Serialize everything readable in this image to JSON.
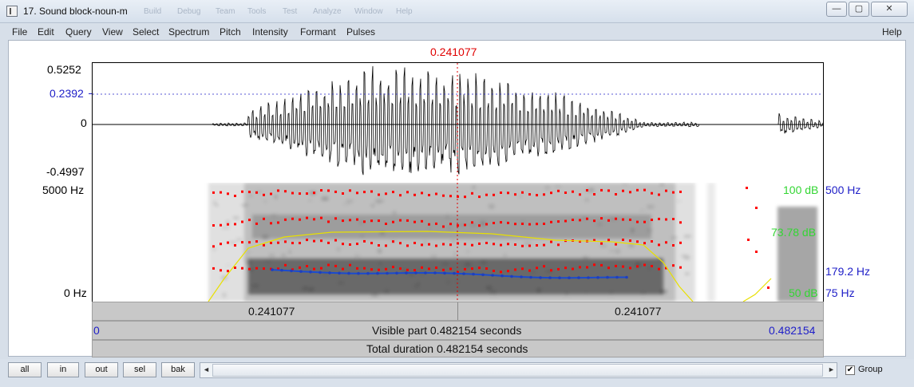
{
  "window": {
    "title": "17. Sound block-noun-m",
    "ghost_menu": [
      "Build",
      "Debug",
      "Team",
      "Tools",
      "Test",
      "Analyze",
      "Window",
      "Help"
    ],
    "minimize_glyph": "—",
    "restore_glyph": "▢",
    "close_glyph": "✕"
  },
  "menu": {
    "items": [
      "File",
      "Edit",
      "Query",
      "View",
      "Select",
      "Spectrum",
      "Pitch",
      "Intensity",
      "Formant",
      "Pulses"
    ],
    "help": "Help"
  },
  "cursor": {
    "time_label": "0.241077",
    "time_s": 0.241077
  },
  "waveform": {
    "max_label": "0.5252",
    "cursor_value_label": "0.2392",
    "zero_label": "0",
    "min_label": "-0.4997"
  },
  "spectrogram": {
    "top_label": "5000 Hz",
    "bottom_label": "0 Hz",
    "intensity_top": "100 dB",
    "intensity_mid": "73.78 dB",
    "intensity_bottom": "50 dB",
    "pitch_top": "500 Hz",
    "pitch_cursor": "179.2 Hz",
    "pitch_bottom": "75 Hz"
  },
  "time_bar": {
    "left_label": "0.241077",
    "right_label": "0.241077"
  },
  "visible_bar": {
    "start": "0",
    "text": "Visible part 0.482154 seconds",
    "end": "0.482154"
  },
  "total_bar": {
    "text": "Total duration 0.482154 seconds"
  },
  "bottom": {
    "buttons": [
      "all",
      "in",
      "out",
      "sel",
      "bak"
    ],
    "scroll_left": "◄",
    "scroll_right": "►",
    "group_label": "Group",
    "group_checked": true
  },
  "colors": {
    "cursor": "#e00000",
    "pitch": "#1a4bd0",
    "intensity_label": "#33d633",
    "intensity_curve": "#e8e000",
    "formant": "#ff0000",
    "axis_blue": "#2020c8"
  }
}
